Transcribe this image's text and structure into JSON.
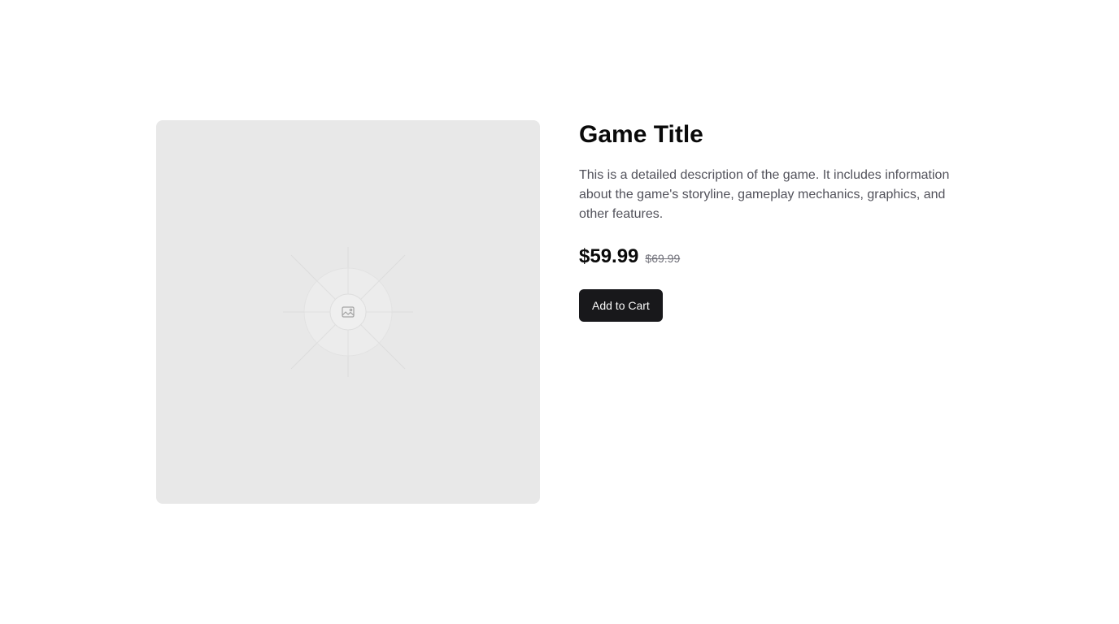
{
  "product": {
    "image_icon": "image-placeholder-icon",
    "title": "Game Title",
    "description": "This is a detailed description of the game. It includes information about the game's storyline, gameplay mechanics, graphics, and other features.",
    "price": "$59.99",
    "original_price": "$69.99",
    "add_to_cart_label": "Add to Cart"
  },
  "colors": {
    "button_bg": "#18181b",
    "image_bg": "#e8e8e8"
  }
}
